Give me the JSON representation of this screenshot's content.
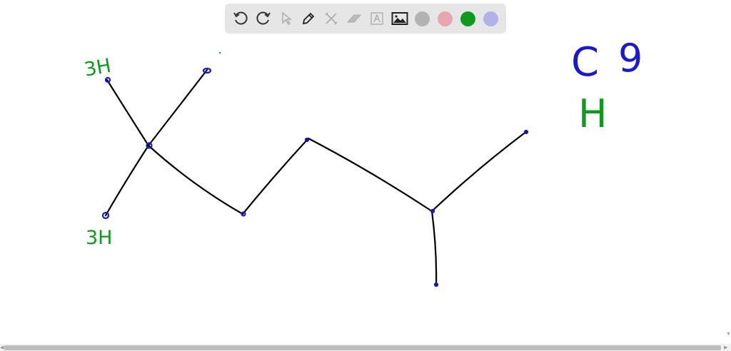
{
  "toolbar": {
    "tools": [
      "undo",
      "redo",
      "select",
      "pen",
      "tools",
      "eraser",
      "text",
      "image"
    ],
    "colors": [
      "#b3b3b3",
      "#e8a5b0",
      "#0f9a1e",
      "#b3b0ea"
    ]
  },
  "annotations": {
    "top_left_h": "3H",
    "bottom_left_h": "3H",
    "carbon_label": "C",
    "carbon_count": "9",
    "hydrogen_label": "H"
  },
  "ink_colors": {
    "bond": "#000000",
    "atom": "#1a1acc",
    "note": "#0f9a1e",
    "formula": "#1a1acc"
  }
}
